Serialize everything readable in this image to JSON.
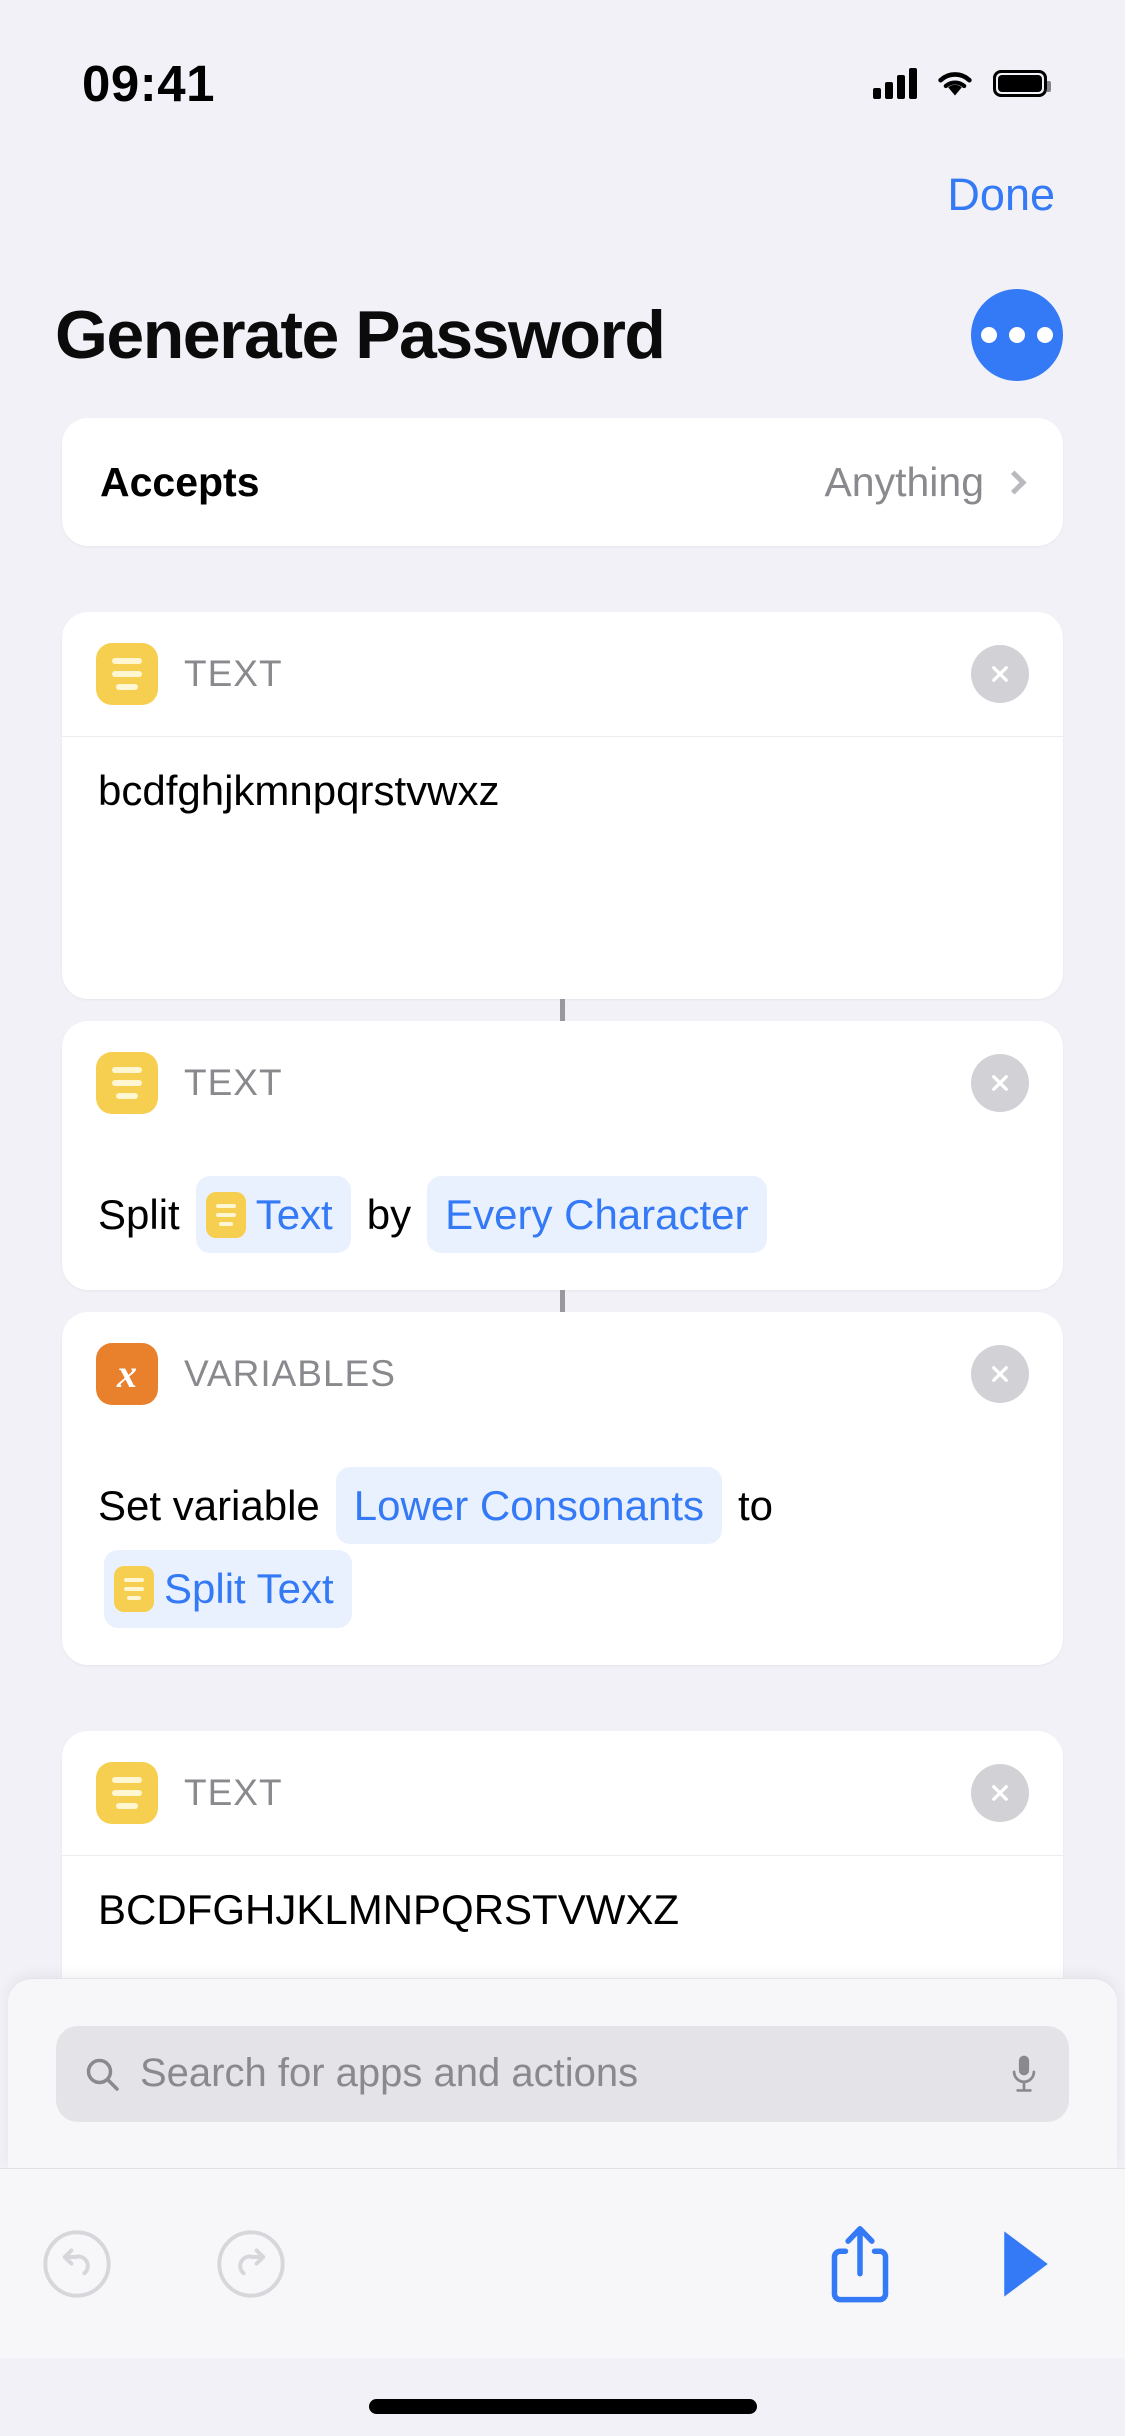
{
  "status_bar": {
    "time": "09:41",
    "signal_icon": "cellular-bars-icon",
    "wifi_icon": "wifi-icon",
    "battery_icon": "battery-full-icon"
  },
  "nav": {
    "done_label": "Done"
  },
  "header": {
    "title": "Generate Password",
    "more_button_icon": "ellipsis-icon"
  },
  "accepts_row": {
    "label": "Accepts",
    "value": "Anything",
    "chevron_icon": "chevron-right-icon"
  },
  "actions": [
    {
      "category": "TEXT",
      "icon": "text-action-icon",
      "icon_color": "#F7CF50",
      "close_icon": "close-circle-icon",
      "body_text": "bcdfghjkmnpqrstvwxz"
    },
    {
      "category": "TEXT",
      "icon": "text-action-icon",
      "icon_color": "#F7CF50",
      "close_icon": "close-circle-icon",
      "tokens": {
        "word1": "Split",
        "pill1": "Text",
        "word2": "by",
        "pill2": "Every Character"
      }
    },
    {
      "category": "VARIABLES",
      "icon": "variables-action-icon",
      "icon_color": "#E8802C",
      "icon_glyph": "x",
      "close_icon": "close-circle-icon",
      "tokens": {
        "word1": "Set variable",
        "pill1": "Lower Consonants",
        "word2": "to",
        "pill2": "Split Text"
      }
    },
    {
      "category": "TEXT",
      "icon": "text-action-icon",
      "icon_color": "#F7CF50",
      "close_icon": "close-circle-icon",
      "body_text": "BCDFGHJKLMNPQRSTVWXZ"
    }
  ],
  "search": {
    "placeholder": "Search for apps and actions",
    "value": "",
    "search_icon": "search-icon",
    "mic_icon": "microphone-icon"
  },
  "toolbar": {
    "undo_icon": "undo-icon",
    "redo_icon": "redo-icon",
    "share_icon": "share-icon",
    "play_icon": "play-icon"
  },
  "colors": {
    "accent_blue": "#3479F6",
    "background": "#F2F1F7",
    "card": "#FFFFFF",
    "text_yellow": "#F7CF50",
    "variables_orange": "#E8802C",
    "pill_background": "#EAF1FE"
  }
}
